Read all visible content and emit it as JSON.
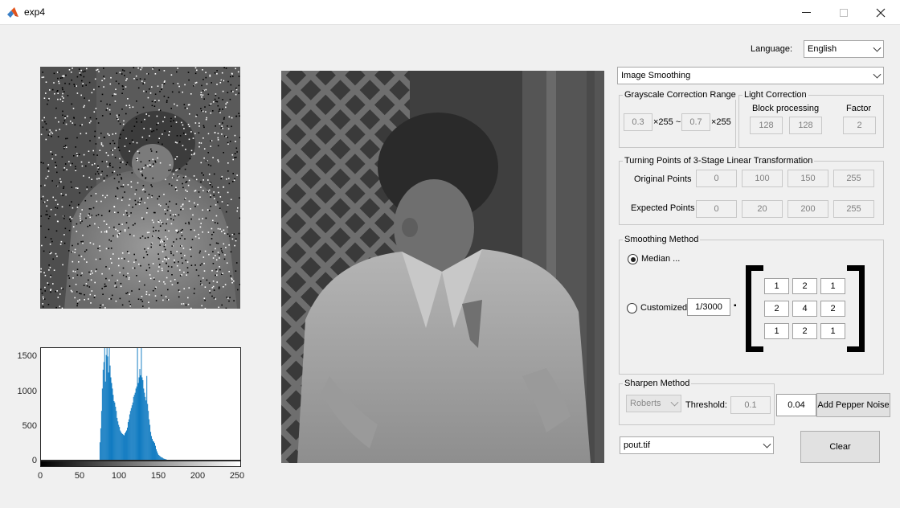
{
  "window": {
    "title": "exp4"
  },
  "language": {
    "label": "Language:",
    "value": "English"
  },
  "operation": {
    "value": "Image Smoothing"
  },
  "grayscale": {
    "title": "Grayscale Correction Range",
    "low": "0.3",
    "unit1": "×255 ~",
    "high": "0.7",
    "unit2": "×255"
  },
  "light": {
    "title": "Light Correction",
    "block_label": "Block processing",
    "factor_label": "Factor",
    "block_w": "128",
    "block_h": "128",
    "factor": "2"
  },
  "linear": {
    "title": "Turning Points of 3-Stage Linear Transformation",
    "original_label": "Original Points",
    "original": [
      "0",
      "100",
      "150",
      "255"
    ],
    "expected_label": "Expected Points",
    "expected": [
      "0",
      "20",
      "200",
      "255"
    ]
  },
  "smoothing": {
    "title": "Smoothing Method",
    "median_label": "Median ...",
    "custom_label": "Customized",
    "coef": "1/3000",
    "times": "▪",
    "kernel": [
      "1",
      "2",
      "1",
      "2",
      "4",
      "2",
      "1",
      "2",
      "1"
    ],
    "selected": "median"
  },
  "sharpen": {
    "title": "Sharpen Method",
    "method": "Roberts",
    "threshold_label": "Threshold:",
    "threshold": "0.1"
  },
  "noise": {
    "value": "0.04",
    "button": "Add Pepper Noise"
  },
  "file": {
    "value": "pout.tif"
  },
  "clear_button": "Clear",
  "histogram": {
    "yticks": [
      "1500",
      "1000",
      "500",
      "0"
    ],
    "xticks": [
      "0",
      "50",
      "100",
      "150",
      "200",
      "250"
    ],
    "bar_color": "#0072bd"
  },
  "chart_data": {
    "type": "bar",
    "title": "",
    "xlabel": "",
    "ylabel": "",
    "xlim": [
      0,
      255
    ],
    "ylim": [
      0,
      1600
    ],
    "series": [
      {
        "x": [
          75,
          76,
          77,
          78,
          79,
          80,
          81,
          82,
          83,
          84,
          85,
          86,
          87,
          88,
          89,
          90,
          91,
          92,
          93,
          94,
          95,
          96,
          97,
          98,
          99,
          100,
          101,
          102,
          103,
          104,
          105,
          106,
          107,
          108,
          109,
          110,
          111,
          112,
          113,
          114,
          115,
          116,
          117,
          118,
          119,
          120,
          121,
          122,
          123,
          124,
          125,
          126,
          127,
          128,
          129,
          130,
          131,
          132,
          133,
          134,
          135,
          136,
          137,
          138,
          139,
          140,
          141,
          142,
          143,
          144,
          145,
          146,
          147,
          148,
          149,
          150,
          151,
          152,
          153,
          154,
          155,
          156,
          157,
          158,
          159,
          160
        ],
        "values": [
          250,
          450,
          700,
          1020,
          1290,
          1400,
          1600,
          1120,
          1500,
          1600,
          1480,
          1250,
          1600,
          1350,
          1180,
          1100,
          1020,
          930,
          840,
          820,
          760,
          700,
          600,
          550,
          500,
          470,
          420,
          400,
          380,
          370,
          360,
          350,
          380,
          400,
          420,
          460,
          540,
          580,
          650,
          700,
          740,
          780,
          820,
          900,
          930,
          960,
          1020,
          1050,
          1600,
          1100,
          1180,
          1300,
          1210,
          1600,
          1180,
          1140,
          1020,
          960,
          900,
          850,
          1200,
          800,
          700,
          580,
          500,
          400,
          340,
          300,
          270,
          260,
          240,
          200,
          150,
          120,
          90,
          70,
          60,
          50,
          40,
          35,
          30,
          20,
          15,
          12,
          8,
          5
        ]
      }
    ]
  }
}
